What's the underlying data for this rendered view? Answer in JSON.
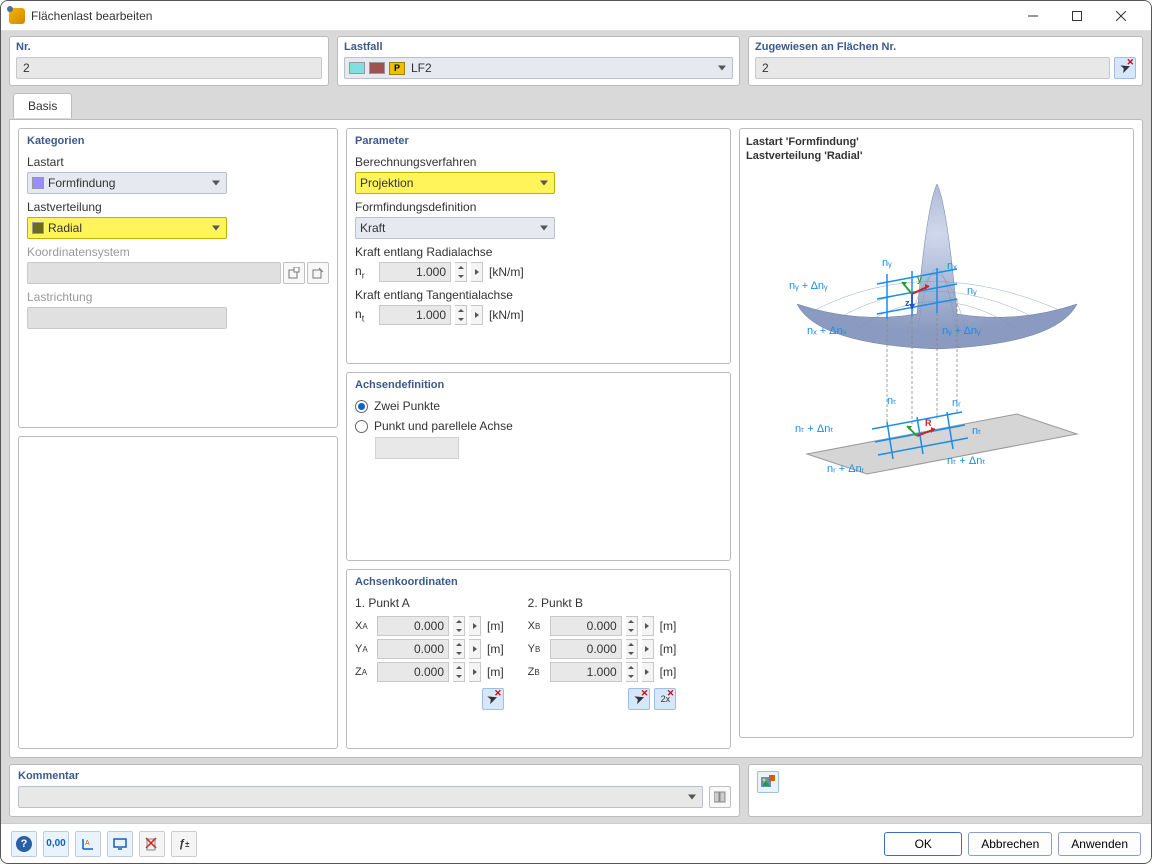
{
  "window": {
    "title": "Flächenlast bearbeiten"
  },
  "top": {
    "nr": {
      "title": "Nr.",
      "value": "2"
    },
    "lastfall": {
      "title": "Lastfall",
      "badge": "P",
      "value": "LF2"
    },
    "assigned": {
      "title": "Zugewiesen an Flächen Nr.",
      "value": "2"
    }
  },
  "tab": {
    "basis": "Basis"
  },
  "cat": {
    "title": "Kategorien",
    "lastart_lbl": "Lastart",
    "lastart_val": "Formfindung",
    "lastvert_lbl": "Lastverteilung",
    "lastvert_val": "Radial",
    "coord_lbl": "Koordinatensystem",
    "dir_lbl": "Lastrichtung"
  },
  "param": {
    "title": "Parameter",
    "calc_lbl": "Berechnungsverfahren",
    "calc_val": "Projektion",
    "ffdef_lbl": "Formfindungsdefinition",
    "ffdef_val": "Kraft",
    "radial_lbl": "Kraft entlang Radialachse",
    "radial_sym": "n",
    "radial_sub": "r",
    "radial_val": "1.000",
    "radial_unit": "[kN/m]",
    "tang_lbl": "Kraft entlang Tangentialachse",
    "tang_sym": "n",
    "tang_sub": "t",
    "tang_val": "1.000",
    "tang_unit": "[kN/m]"
  },
  "axis_def": {
    "title": "Achsendefinition",
    "opt1": "Zwei Punkte",
    "opt2": "Punkt und parellele Achse"
  },
  "axis_coord": {
    "title": "Achsenkoordinaten",
    "ptA": "1. Punkt A",
    "ptB": "2. Punkt B",
    "xa": "0.000",
    "ya": "0.000",
    "za": "0.000",
    "xb": "0.000",
    "yb": "0.000",
    "zb": "1.000",
    "unit": "[m]",
    "lbl_x": "X",
    "lbl_y": "Y",
    "lbl_z": "Z",
    "sub_a": "A",
    "sub_b": "B"
  },
  "preview": {
    "line1": "Lastart 'Formfindung'",
    "line2": "Lastverteilung 'Radial'"
  },
  "comment": {
    "title": "Kommentar"
  },
  "buttons": {
    "ok": "OK",
    "cancel": "Abbrechen",
    "apply": "Anwenden"
  }
}
